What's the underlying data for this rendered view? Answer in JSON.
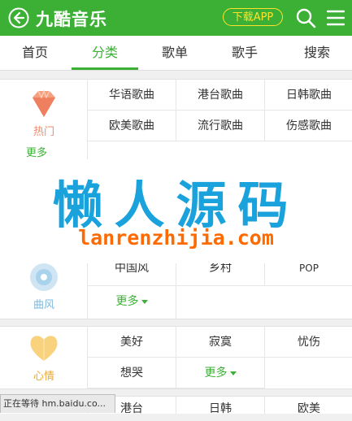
{
  "header": {
    "title": "九酷音乐",
    "download_label": "下载APP"
  },
  "nav": {
    "tabs": [
      "首页",
      "分类",
      "歌单",
      "歌手",
      "搜索"
    ],
    "active": 1
  },
  "sections": {
    "hot": {
      "label": "热门",
      "color": "#f08a6c",
      "items": [
        "华语歌曲",
        "港台歌曲",
        "日韩歌曲",
        "欧美歌曲",
        "流行歌曲",
        "伤感歌曲"
      ],
      "more_partial": "更多"
    },
    "style": {
      "label": "曲风",
      "color": "#9cc8e4",
      "items": [
        "中国风",
        "乡村",
        "POP"
      ],
      "more": "更多"
    },
    "mood": {
      "label": "心情",
      "color": "#f5c04a",
      "items": [
        "美好",
        "寂寞",
        "忧伤",
        "想哭"
      ],
      "more": "更多"
    },
    "bottom": {
      "items": [
        "港台",
        "日韩",
        "欧美"
      ]
    }
  },
  "watermark": {
    "cn": "懒人源码",
    "en": "lanrenzhijia.com"
  },
  "status": {
    "text": "正在等待 hm.baidu.co..."
  },
  "colors": {
    "brand": "#3cb035",
    "accent": "#ffe32a"
  }
}
